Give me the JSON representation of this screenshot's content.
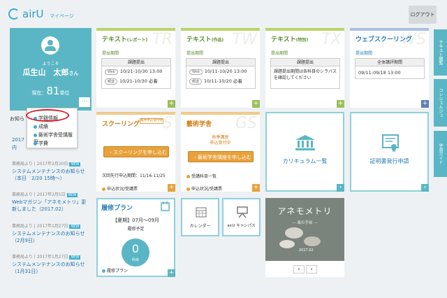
{
  "header": {
    "logo_text": "airU",
    "logo_sub": "マイページ",
    "logout_label": "ログアウト"
  },
  "profile": {
    "welcome": "ようこそ",
    "name": "瓜生山　太郎",
    "honorific": "さん",
    "credits_label": "現在：",
    "credits_value": "81",
    "credits_unit": "単位",
    "more_label": "…"
  },
  "dropdown": {
    "items": [
      "学籍情報",
      "成績",
      "藝術学舎受講履歴",
      "学費"
    ]
  },
  "notices": {
    "title": "お知ら",
    "first_fragments": [
      "2017",
      "内"
    ],
    "items": [
      {
        "meta": "事務局より | 2017年2月20日",
        "badge": "NEW",
        "text": "システムメンテナンスのお知らせ（本日　2/20 15時～）"
      },
      {
        "meta": "事務局より | 2017年2月5日",
        "badge": "NEW",
        "text": "Webマガジン「アネモメトリ」更新しました（2017.02）"
      },
      {
        "meta": "事務局より | 2017年1月27日",
        "badge": "NEW",
        "text": "システムメンテナンスのお知らせ（2月9日）"
      },
      {
        "meta": "事務局より | 2017年1月27日",
        "badge": "NEW",
        "text": "システムメンテナンスのお知らせ（1月31日）"
      }
    ]
  },
  "cards": {
    "report": {
      "title": "テキスト",
      "title_sub": "(レポート)",
      "bg": "TR",
      "period_label": "提出期間",
      "table_head": "課題提出",
      "rows": [
        {
          "tag": "Web",
          "text": "10/21-10/30 13:00"
        },
        {
          "tag": "郵送",
          "text": "10/21-10/30 必着"
        }
      ],
      "plus": "+"
    },
    "work": {
      "title": "テキスト",
      "title_sub": "(作品)",
      "bg": "TW",
      "period_label": "提出期間",
      "table_head": "課題提出",
      "rows": [
        {
          "tag": "Web",
          "text": "10/11-10/20 13:00"
        },
        {
          "tag": "郵送",
          "text": "10/11-10/20 必着"
        }
      ],
      "plus": "+"
    },
    "special": {
      "title": "テキスト",
      "title_sub": "(特別)",
      "bg": "TX",
      "period_label": "提出期間",
      "table_head": "課題提出",
      "note": "課題提出期間は各科目のシラバスを確認してください",
      "plus": "+"
    },
    "webschool": {
      "title": "ウェブスクーリング",
      "bg": "WS",
      "period_label": "提出期間",
      "table_head": "全体講評期間",
      "row": "09/11-09/18 13:00",
      "plus": "+"
    },
    "schooling": {
      "title": "スクーリング",
      "badge": "集中申込受付中",
      "bg": "S",
      "button": "スクーリングを申し込む",
      "note": "次回先行申込期間：11/16-11/25",
      "link": "申込状況/受講票",
      "plus": "+"
    },
    "geijutsu": {
      "title": "藝術学舎",
      "bg": "GS",
      "badge_line1": "秋季講座",
      "badge_line2": "申込受付中",
      "button": "藝術学舎講座を申し込む",
      "link1": "受講科目一覧",
      "link2": "申込状況/受講票",
      "plus": "+"
    },
    "curriculum": {
      "label": "カリキュラム一覧",
      "arrow": "›"
    },
    "certificate": {
      "label": "証明書発行申請",
      "arrow": "›"
    },
    "plan": {
      "title": "履修プラン",
      "term": "【夏期】07月～09月",
      "status": "履修予定",
      "count": "0",
      "count_unit": "科目",
      "link": "履修プラン",
      "plus": "+"
    },
    "calendar": {
      "label": "カレンダー"
    },
    "campus": {
      "label": "airU キャンパス"
    },
    "banner": {
      "title": "アネモメトリ",
      "subtitle": "― 風の手帖 ―",
      "date": "2017.02",
      "prev": "‹",
      "next": "›"
    }
  },
  "right_tabs": [
    {
      "label": "テキスト閲覧",
      "color": "#5ab6c4"
    },
    {
      "label": "コンシェルジュ",
      "color": "#5ab6c4"
    },
    {
      "label": "学習ガイド",
      "color": "#5ab6c4"
    }
  ]
}
